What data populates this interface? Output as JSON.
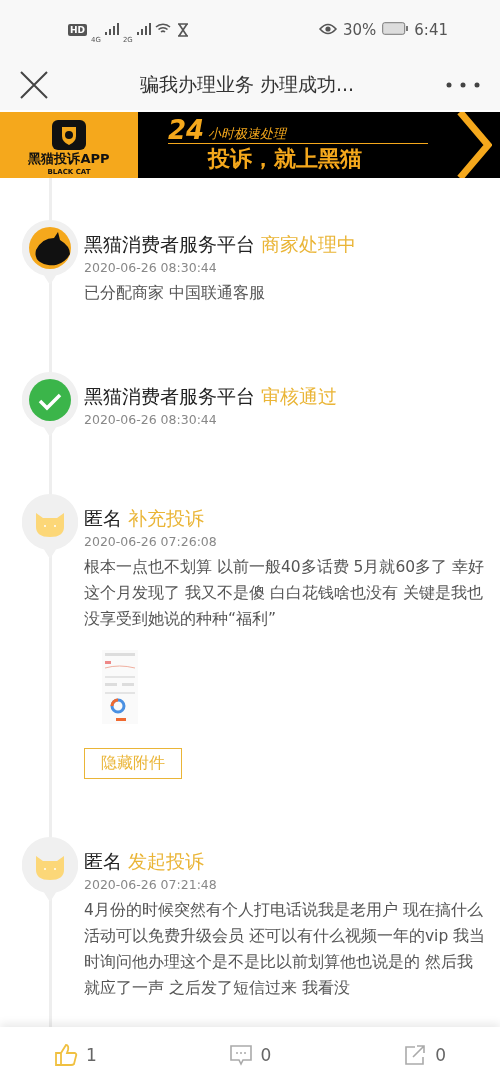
{
  "status_bar": {
    "network_labels": [
      "HD",
      "4G",
      "2G"
    ],
    "battery": "30%",
    "time": "6:41"
  },
  "nav": {
    "title": "骗我办理业务 办理成功..."
  },
  "banner": {
    "app_name": "黑猫投诉APP",
    "app_sub": "BLACK CAT",
    "badge": "24",
    "tagline": "小时极速处理",
    "slogan": "投诉，就上黑猫"
  },
  "timeline": [
    {
      "kind": "platform",
      "author": "黑猫消费者服务平台",
      "status": "商家处理中",
      "time": "2020-06-26 08:30:44",
      "body": "已分配商家 中国联通客服"
    },
    {
      "kind": "approved",
      "author": "黑猫消费者服务平台",
      "status": "审核通过",
      "time": "2020-06-26 08:30:44"
    },
    {
      "kind": "anonymous",
      "author": "匿名",
      "status": "补充投诉",
      "time": "2020-06-26 07:26:08",
      "body": "根本一点也不划算 以前一般40多话费 5月就60多了 幸好这个月发现了 我又不是傻 白白花钱啥也没有 关键是我也没享受到她说的种种“福利”",
      "action": "隐藏附件"
    },
    {
      "kind": "anonymous",
      "author": "匿名",
      "status": "发起投诉",
      "time": "2020-06-26 07:21:48",
      "body": "4月份的时候突然有个人打电话说我是老用户 现在搞什么活动可以免费升级会员 还可以有什么视频一年的vip 我当时询问他办理这个是不是比以前划算他也说是的 然后我就应了一声 之后发了短信过来 我看没"
    }
  ],
  "actions": [
    {
      "kind": "like",
      "count": "1",
      "selected": true
    },
    {
      "kind": "comment",
      "count": "0",
      "selected": false
    },
    {
      "kind": "share",
      "count": "0",
      "selected": false
    }
  ]
}
